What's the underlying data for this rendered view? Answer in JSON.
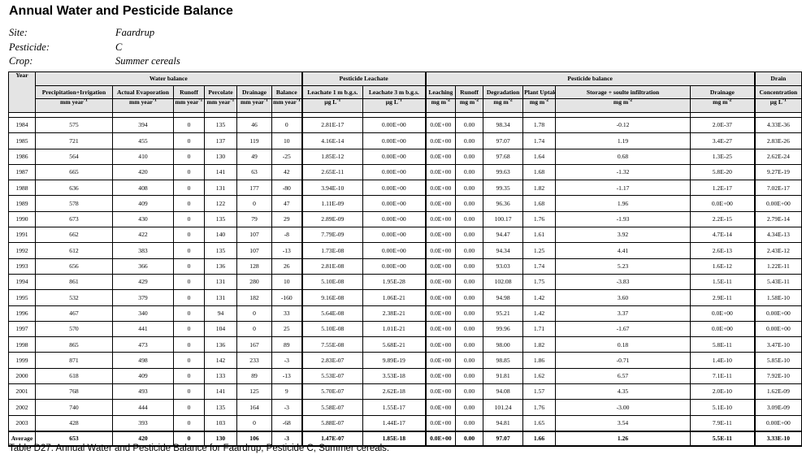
{
  "title": "Annual Water and Pesticide Balance",
  "meta": [
    {
      "key": "Site:",
      "value": "Faardrup"
    },
    {
      "key": "Pesticide:",
      "value": "C"
    },
    {
      "key": "Crop:",
      "value": "Summer cereals"
    }
  ],
  "groups": {
    "year": "Year",
    "water": "Water balance",
    "leachate": "Pesticide Leachate",
    "pesticide": "Pesticide balance",
    "drain": "Drain"
  },
  "headers": [
    "Precipitation+Irrigation",
    "Actual Evaporation",
    "Runoff",
    "Percolate",
    "Drainage",
    "Balance",
    "Leachate 1 m b.g.s.",
    "Leachate 3 m b.g.s.",
    "Leaching",
    "Runoff",
    "Degradation",
    "Plant Uptake",
    "Storage + soulte infiltration",
    "Drainage",
    "Concentration"
  ],
  "units": [
    {
      "base": "mm year",
      "sup": "-1"
    },
    {
      "base": "mm year",
      "sup": "-1"
    },
    {
      "base": "mm year",
      "sup": "-1"
    },
    {
      "base": "mm year",
      "sup": "-1"
    },
    {
      "base": "mm year",
      "sup": "-1"
    },
    {
      "base": "mm year",
      "sup": "-1"
    },
    {
      "base": "µg L",
      "sup": "-1"
    },
    {
      "base": "µg L",
      "sup": "-1"
    },
    {
      "base": "mg m",
      "sup": "-2"
    },
    {
      "base": "mg m",
      "sup": "-2"
    },
    {
      "base": "mg m",
      "sup": "-2"
    },
    {
      "base": "mg m",
      "sup": "-2"
    },
    {
      "base": "mg m",
      "sup": "-2"
    },
    {
      "base": "mg m",
      "sup": "-2"
    },
    {
      "base": "µg L",
      "sup": "-1"
    }
  ],
  "rows": [
    [
      "1984",
      "575",
      "394",
      "0",
      "135",
      "46",
      "0",
      "2.81E-17",
      "0.00E+00",
      "0.0E+00",
      "0.00",
      "98.34",
      "1.78",
      "-0.12",
      "2.0E-37",
      "4.33E-36"
    ],
    [
      "1985",
      "721",
      "455",
      "0",
      "137",
      "119",
      "10",
      "4.16E-14",
      "0.00E+00",
      "0.0E+00",
      "0.00",
      "97.07",
      "1.74",
      "1.19",
      "3.4E-27",
      "2.83E-26"
    ],
    [
      "1986",
      "564",
      "410",
      "0",
      "130",
      "49",
      "-25",
      "1.85E-12",
      "0.00E+00",
      "0.0E+00",
      "0.00",
      "97.68",
      "1.64",
      "0.68",
      "1.3E-25",
      "2.62E-24"
    ],
    [
      "1987",
      "665",
      "420",
      "0",
      "141",
      "63",
      "42",
      "2.65E-11",
      "0.00E+00",
      "0.0E+00",
      "0.00",
      "99.63",
      "1.68",
      "-1.32",
      "5.8E-20",
      "9.27E-19"
    ],
    [
      "1988",
      "636",
      "408",
      "0",
      "131",
      "177",
      "-80",
      "3.94E-10",
      "0.00E+00",
      "0.0E+00",
      "0.00",
      "99.35",
      "1.82",
      "-1.17",
      "1.2E-17",
      "7.02E-17"
    ],
    [
      "1989",
      "578",
      "409",
      "0",
      "122",
      "0",
      "47",
      "1.11E-09",
      "0.00E+00",
      "0.0E+00",
      "0.00",
      "96.36",
      "1.68",
      "1.96",
      "0.0E+00",
      "0.00E+00"
    ],
    [
      "1990",
      "673",
      "430",
      "0",
      "135",
      "79",
      "29",
      "2.89E-09",
      "0.00E+00",
      "0.0E+00",
      "0.00",
      "100.17",
      "1.76",
      "-1.93",
      "2.2E-15",
      "2.79E-14"
    ],
    [
      "1991",
      "662",
      "422",
      "0",
      "140",
      "107",
      "-8",
      "7.79E-09",
      "0.00E+00",
      "0.0E+00",
      "0.00",
      "94.47",
      "1.61",
      "3.92",
      "4.7E-14",
      "4.34E-13"
    ],
    [
      "1992",
      "612",
      "383",
      "0",
      "135",
      "107",
      "-13",
      "1.73E-08",
      "0.00E+00",
      "0.0E+00",
      "0.00",
      "94.34",
      "1.25",
      "4.41",
      "2.6E-13",
      "2.43E-12"
    ],
    [
      "1993",
      "656",
      "366",
      "0",
      "136",
      "128",
      "26",
      "2.81E-08",
      "0.00E+00",
      "0.0E+00",
      "0.00",
      "93.03",
      "1.74",
      "5.23",
      "1.6E-12",
      "1.22E-11"
    ],
    [
      "1994",
      "861",
      "429",
      "0",
      "131",
      "280",
      "10",
      "5.10E-08",
      "1.95E-28",
      "0.0E+00",
      "0.00",
      "102.08",
      "1.75",
      "-3.83",
      "1.5E-11",
      "5.43E-11"
    ],
    [
      "1995",
      "532",
      "379",
      "0",
      "131",
      "182",
      "-160",
      "9.16E-08",
      "1.06E-21",
      "0.0E+00",
      "0.00",
      "94.98",
      "1.42",
      "3.60",
      "2.9E-11",
      "1.58E-10"
    ],
    [
      "1996",
      "467",
      "340",
      "0",
      "94",
      "0",
      "33",
      "5.64E-08",
      "2.38E-21",
      "0.0E+00",
      "0.00",
      "95.21",
      "1.42",
      "3.37",
      "0.0E+00",
      "0.00E+00"
    ],
    [
      "1997",
      "570",
      "441",
      "0",
      "104",
      "0",
      "25",
      "5.10E-08",
      "1.01E-21",
      "0.0E+00",
      "0.00",
      "99.96",
      "1.71",
      "-1.67",
      "0.0E+00",
      "0.00E+00"
    ],
    [
      "1998",
      "865",
      "473",
      "0",
      "136",
      "167",
      "89",
      "7.55E-08",
      "5.68E-21",
      "0.0E+00",
      "0.00",
      "98.00",
      "1.82",
      "0.18",
      "5.8E-11",
      "3.47E-10"
    ],
    [
      "1999",
      "871",
      "498",
      "0",
      "142",
      "233",
      "-3",
      "2.83E-07",
      "9.89E-19",
      "0.0E+00",
      "0.00",
      "98.85",
      "1.86",
      "-0.71",
      "1.4E-10",
      "5.85E-10"
    ],
    [
      "2000",
      "618",
      "409",
      "0",
      "133",
      "89",
      "-13",
      "5.53E-07",
      "3.53E-18",
      "0.0E+00",
      "0.00",
      "91.81",
      "1.62",
      "6.57",
      "7.1E-11",
      "7.92E-10"
    ],
    [
      "2001",
      "768",
      "493",
      "0",
      "141",
      "125",
      "9",
      "5.70E-07",
      "2.62E-18",
      "0.0E+00",
      "0.00",
      "94.08",
      "1.57",
      "4.35",
      "2.0E-10",
      "1.62E-09"
    ],
    [
      "2002",
      "740",
      "444",
      "0",
      "135",
      "164",
      "-3",
      "5.58E-07",
      "1.55E-17",
      "0.0E+00",
      "0.00",
      "101.24",
      "1.76",
      "-3.00",
      "5.1E-10",
      "3.09E-09"
    ],
    [
      "2003",
      "428",
      "393",
      "0",
      "103",
      "0",
      "-68",
      "5.88E-07",
      "1.44E-17",
      "0.0E+00",
      "0.00",
      "94.81",
      "1.65",
      "3.54",
      "7.9E-11",
      "0.00E+00"
    ]
  ],
  "average": [
    "Average",
    "653",
    "420",
    "0",
    "130",
    "106",
    "-3",
    "1.47E-07",
    "1.85E-18",
    "0.0E+00",
    "0.00",
    "97.07",
    "1.66",
    "1.26",
    "5.5E-11",
    "3.33E-10"
  ],
  "caption": "Table D27. Annual Water and Pesticide Balance for Faardrup, Pesticide C, Summer cereals."
}
